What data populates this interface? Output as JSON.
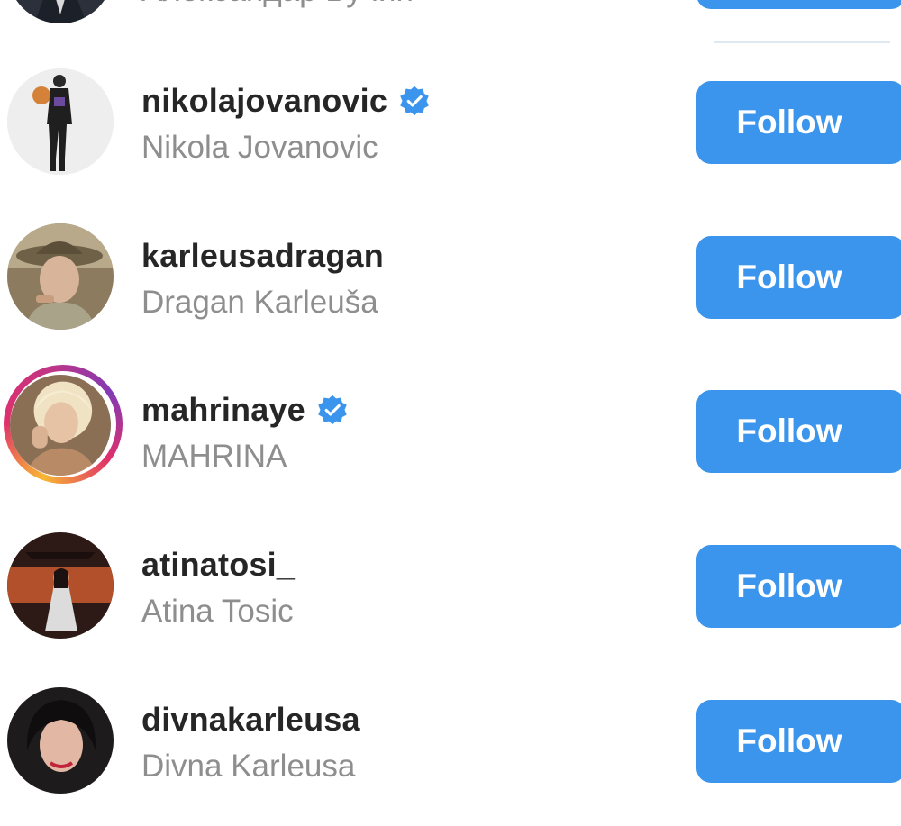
{
  "top_partial": {
    "fullname": "Александар Вучић"
  },
  "rows": [
    {
      "username": "nikolajovanovic",
      "fullname": "Nikola Jovanovic",
      "verified": true,
      "follow_label": "Follow"
    },
    {
      "username": "karleusadragan",
      "fullname": "Dragan Karleuša",
      "verified": false,
      "follow_label": "Follow"
    },
    {
      "username": "mahrinaye",
      "fullname": "MAHRINA",
      "verified": true,
      "follow_label": "Follow",
      "story_ring": true
    },
    {
      "username": "atinatosi_",
      "fullname": "Atina Tosic",
      "verified": false,
      "follow_label": "Follow"
    },
    {
      "username": "divnakarleusa",
      "fullname": "Divna Karleusa",
      "verified": false,
      "follow_label": "Follow"
    }
  ],
  "colors": {
    "follow_button": "#3b95ed",
    "verified_badge": "#3b95ed",
    "username": "#262626",
    "fullname": "#8e8e8e"
  }
}
